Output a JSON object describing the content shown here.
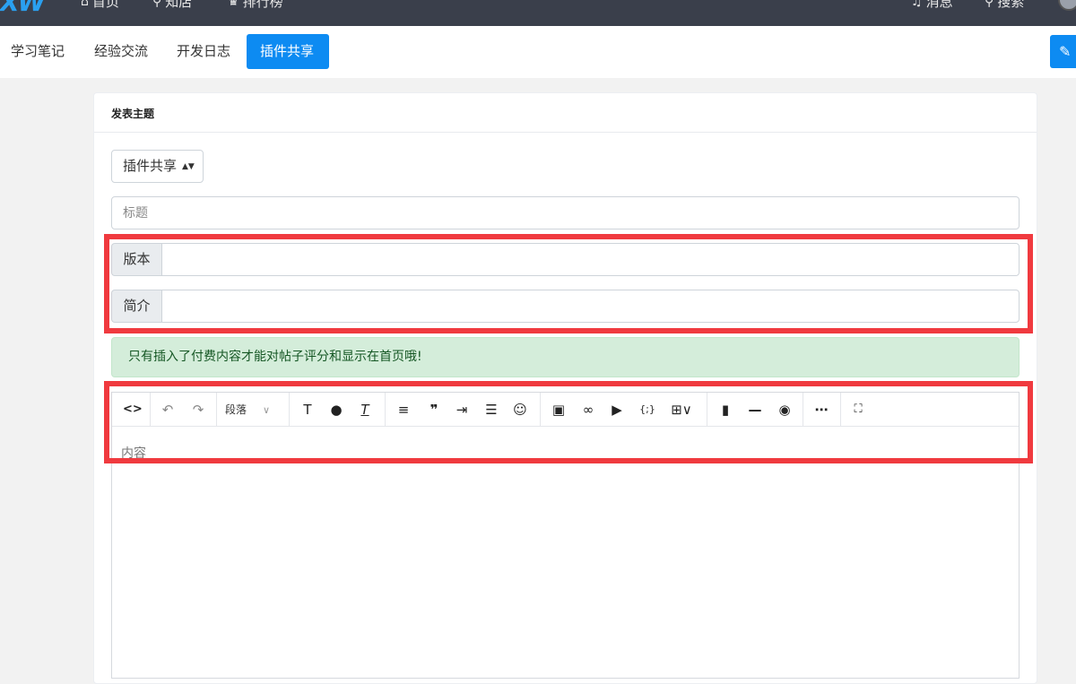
{
  "topnav": {
    "logo": "XW",
    "items": [
      {
        "icon": "home-icon",
        "glyph": "⌂",
        "label": "首页"
      },
      {
        "icon": "link-icon",
        "glyph": "⚲",
        "label": "知店"
      },
      {
        "icon": "trophy-icon",
        "glyph": "♛",
        "label": "排行榜"
      }
    ],
    "right_items": [
      {
        "icon": "bell-icon",
        "glyph": "♫",
        "label": "消息"
      },
      {
        "icon": "search-icon",
        "glyph": "⚲",
        "label": "搜索"
      }
    ]
  },
  "subnav": {
    "tabs": [
      {
        "label": "学习笔记",
        "active": false
      },
      {
        "label": "经验交流",
        "active": false
      },
      {
        "label": "开发日志",
        "active": false
      },
      {
        "label": "插件共享",
        "active": true
      }
    ],
    "edit_icon": "edit-icon"
  },
  "card": {
    "title": "发表主题",
    "category_select": {
      "value": "插件共享"
    },
    "title_input": {
      "placeholder": "标题",
      "value": ""
    },
    "version_field": {
      "addon": "版本",
      "value": ""
    },
    "summary_field": {
      "addon": "简介",
      "value": ""
    },
    "alert": "只有插入了付费内容才能对帖子评分和显示在首页哦!",
    "editor": {
      "paragraph_select": "段落",
      "toolbar_icons": [
        "code-view-icon",
        "undo-icon",
        "redo-icon",
        "paragraph-select",
        "text-format-icon",
        "color-drop-icon",
        "clear-format-icon",
        "align-icon",
        "blockquote-icon",
        "indent-icon",
        "list-icon",
        "emoji-icon",
        "image-icon",
        "link-icon",
        "video-icon",
        "code-block-icon",
        "table-icon",
        "bookmark-icon",
        "horizontal-rule-icon",
        "preview-eye-icon",
        "more-icon",
        "fullscreen-icon"
      ],
      "content_placeholder": "内容"
    }
  },
  "colors": {
    "primary": "#0d8bf2",
    "topnav_bg": "#3a3f4b",
    "alert_bg": "#d4edda",
    "alert_text": "#155724",
    "highlight_box": "#f03a3f"
  }
}
